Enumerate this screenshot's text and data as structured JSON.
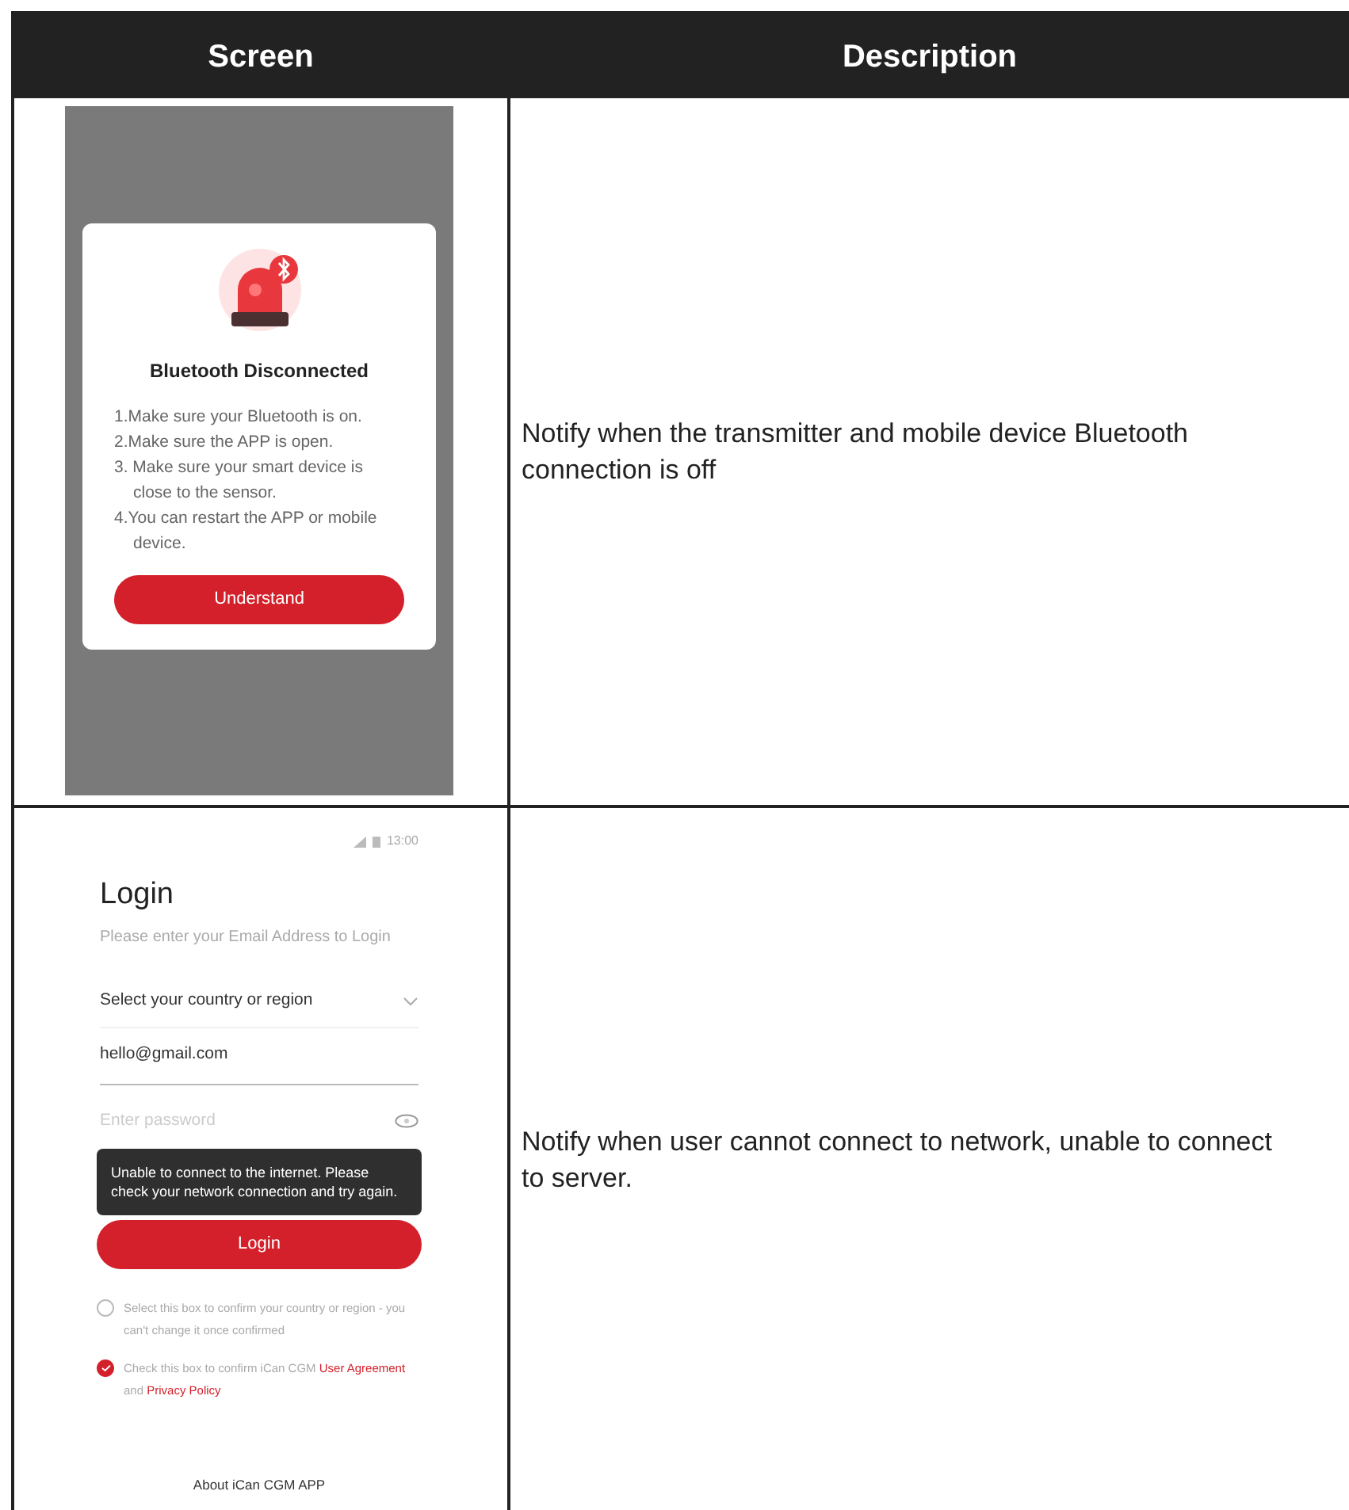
{
  "table": {
    "columns": [
      "Screen",
      "Description"
    ],
    "rows": [
      {
        "kind": "bluetooth",
        "description": "Notify when the transmitter and mobile device Bluetooth connection is off",
        "dialog": {
          "title": "Bluetooth Disconnected",
          "steps": [
            {
              "text": "1.Make sure your Bluetooth is on."
            },
            {
              "text": "2.Make sure the APP is open."
            },
            {
              "text": "3. Make sure your smart device is close to the sensor."
            },
            {
              "text": "4.You can restart the APP or mobile device."
            }
          ],
          "button": "Understand"
        }
      },
      {
        "kind": "login",
        "description": "Notify when user cannot connect to  network,  unable to connect to server.",
        "login": {
          "status_time": "13:00",
          "title": "Login",
          "subtitle": "Please enter your Email Address to Login",
          "country": "Select your country or region",
          "email": "hello@gmail.com",
          "password_placeholder": "Enter password",
          "toast": "Unable to connect to the internet. Please check your network connection and try again.",
          "button": "Login",
          "checks": [
            {
              "checked": false,
              "parts": [
                {
                  "kind": "text",
                  "text": "Select this box to confirm your country or region - you can't change it once confirmed"
                }
              ]
            },
            {
              "checked": true,
              "parts": [
                {
                  "kind": "text",
                  "text": "Check this box to confirm iCan CGM "
                },
                {
                  "kind": "link",
                  "text": "User Agreement"
                },
                {
                  "kind": "text",
                  "text": " and "
                },
                {
                  "kind": "link",
                  "text": "Privacy Policy"
                }
              ]
            }
          ],
          "footer": "About iCan CGM APP"
        }
      }
    ]
  }
}
